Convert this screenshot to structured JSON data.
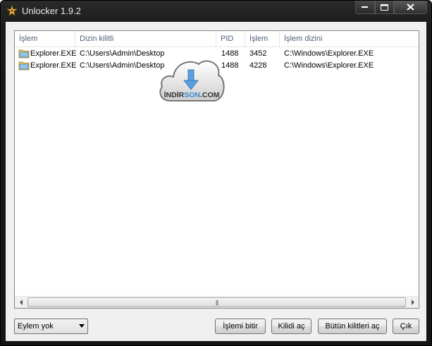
{
  "window": {
    "title": "Unlocker 1.9.2"
  },
  "table": {
    "columns": [
      "İşlem",
      "Dizin kilitli",
      "PID",
      "İşlem",
      "İşlem dizini"
    ],
    "rows": [
      {
        "process": "Explorer.EXE",
        "locked_path": "C:\\Users\\Admin\\Desktop",
        "pid": "1488",
        "handle": "3452",
        "process_path": "C:\\Windows\\Explorer.EXE"
      },
      {
        "process": "Explorer.EXE",
        "locked_path": "C:\\Users\\Admin\\Desktop",
        "pid": "1488",
        "handle": "4228",
        "process_path": "C:\\Windows\\Explorer.EXE"
      }
    ]
  },
  "watermark": {
    "text_left": "İNDİR",
    "text_accent": "SON",
    "text_right": ".COM"
  },
  "footer": {
    "action_select": "Eylem yok",
    "kill_process_label": "İşlemi bitir",
    "unlock_label": "Kilidi aç",
    "unlock_all_label": "Bütün kilitleri aç",
    "quit_label": "Çık"
  }
}
